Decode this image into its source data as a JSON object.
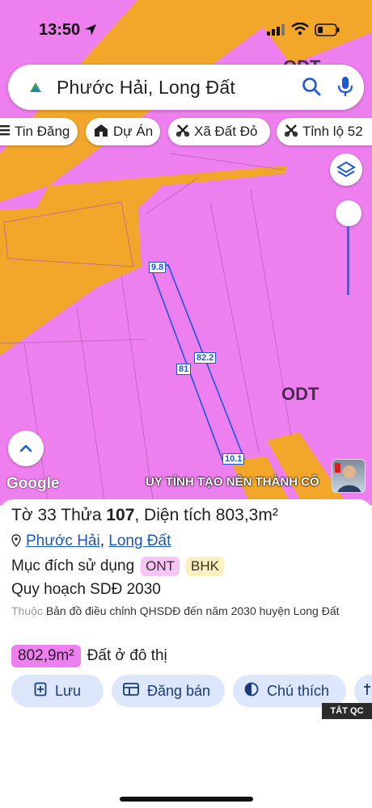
{
  "status_bar": {
    "time": "13:50"
  },
  "search": {
    "query": "Phước Hải, Long Đất"
  },
  "chips": [
    {
      "label": "Tin Đăng",
      "icon": "list-icon"
    },
    {
      "label": "Dự Án",
      "icon": "building-icon"
    },
    {
      "label": "Xã Đất Đỏ",
      "icon": "scissors-icon"
    },
    {
      "label": "Tỉnh lộ 52",
      "icon": "scissors-icon"
    }
  ],
  "map": {
    "zone_labels": [
      "ODT",
      "ODT"
    ],
    "dimensions": [
      "9.8",
      "82.2",
      "81",
      "10.1"
    ],
    "attribution": "Google",
    "ad_banner": "UY TÍNH TẠO NÊN THÀNH CÔ"
  },
  "parcel": {
    "title_prefix": "Tờ ",
    "sheet_no": "33",
    "title_mid": " Thửa ",
    "lot_no": "107",
    "area_prefix": ", Diện tích ",
    "area": "803,3m²",
    "ward": "Phước Hải",
    "district": "Long Đất",
    "purpose_label": "Mục đích sử dụng",
    "purpose_tags": [
      "ONT",
      "BHK"
    ],
    "plan_label": "Quy hoạch SDĐ 2030",
    "source_prefix": "Thuộc",
    "source_text": "Bản đồ điều chỉnh QHSDĐ đến năm 2030 huyện Long Đất",
    "planned_area": "802,9m²",
    "planned_use": "Đất ở đô thị"
  },
  "actions": [
    {
      "label": "Lưu",
      "icon": "bookmark-plus-icon"
    },
    {
      "label": "Đăng bán",
      "icon": "listing-icon"
    },
    {
      "label": "Chú thích",
      "icon": "half-circle-icon"
    }
  ],
  "ad_close": "TẮT QC",
  "colors": {
    "land": "#ee7fee",
    "road": "#f2a62a",
    "accent": "#1a56c2"
  }
}
